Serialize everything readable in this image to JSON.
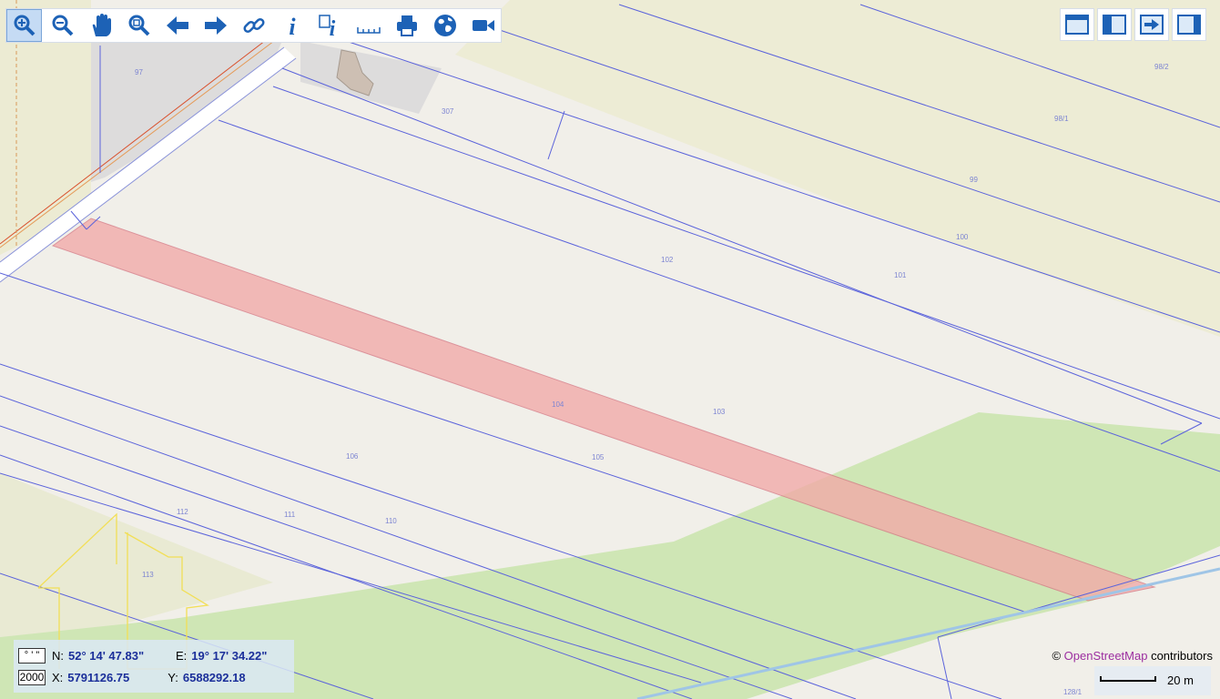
{
  "toolbar": {
    "tools": [
      {
        "name": "zoom-in-tool-icon",
        "active": true
      },
      {
        "name": "zoom-out-tool-icon"
      },
      {
        "name": "pan-hand-icon"
      },
      {
        "name": "zoom-extent-icon"
      },
      {
        "name": "back-arrow-icon"
      },
      {
        "name": "forward-arrow-icon"
      },
      {
        "name": "link-icon"
      },
      {
        "name": "info-icon"
      },
      {
        "name": "info-query-icon"
      },
      {
        "name": "ruler-icon"
      },
      {
        "name": "print-icon"
      },
      {
        "name": "globe-icon"
      },
      {
        "name": "video-camera-icon"
      }
    ],
    "right_tools": [
      {
        "name": "window-layout-icon"
      },
      {
        "name": "left-panel-icon"
      },
      {
        "name": "export-arrow-icon"
      },
      {
        "name": "right-panel-icon"
      }
    ]
  },
  "parcels": {
    "labels": [
      "97",
      "307",
      "98/2",
      "98/1",
      "99",
      "100",
      "101",
      "102",
      "103",
      "104",
      "105",
      "106",
      "110",
      "111",
      "112",
      "113",
      "128/1"
    ]
  },
  "coordinates": {
    "format_label": "° ' \"",
    "scale_label": "2000",
    "n_label": "N:",
    "n_value": "52° 14' 47.83\"",
    "e_label": "E:",
    "e_value": "19° 17' 34.22\"",
    "x_label": "X:",
    "x_value": "5791126.75",
    "y_label": "Y:",
    "y_value": "6588292.18"
  },
  "attribution": {
    "prefix": "© ",
    "link": "OpenStreetMap",
    "suffix": " contributors"
  },
  "scale_bar": {
    "label": "20 m"
  },
  "colors": {
    "parcel_line": "#5561d8",
    "selected_parcel": "#f2a9a8",
    "meadow": "#cfe6b5",
    "farmland": "#ece8d2",
    "toolbar_icon": "#1d62b6"
  }
}
